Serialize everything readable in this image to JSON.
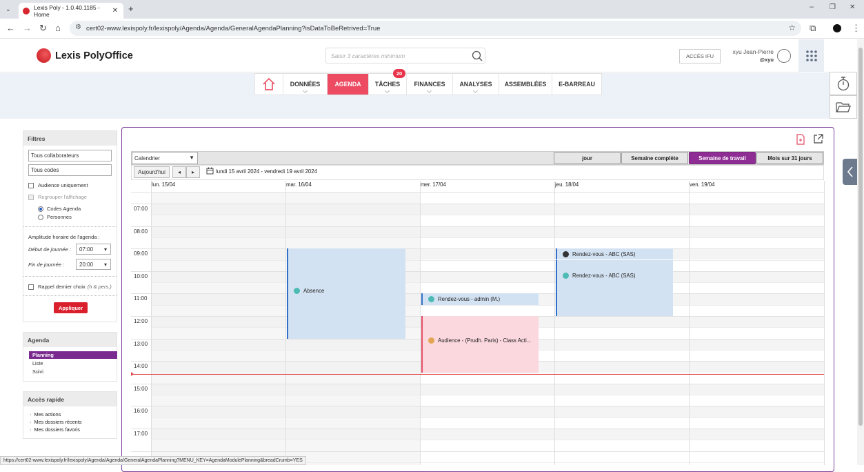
{
  "browser": {
    "tab_title": "Lexis Poly - 1.0.40.1185 - Home",
    "new_tab": "+",
    "url": "cert02-www.lexispoly.fr/lexispoly/Agenda/Agenda/GeneralAgendaPlanning?isDataToBeRetrived=True",
    "status_url": "https://cert02-www.lexispoly.fr/lexispoly/Agenda/Agenda/GeneralAgendaPlanning?MENU_KEY=AgendaModulePlanning&breadCrumb=YES"
  },
  "header": {
    "brand": "Lexis PolyOffice",
    "search_placeholder": "Saisir 3 caractères minimum",
    "ifu_button": "ACCÈS IFU",
    "user_name": "xyu Jean-Pierre",
    "user_login": "@xyu"
  },
  "nav": {
    "items": [
      "DONNÉES",
      "AGENDA",
      "TÂCHES",
      "FINANCES",
      "ANALYSES",
      "ASSEMBLÉES",
      "E-BARREAU"
    ],
    "active": "AGENDA",
    "tasks_badge": "20"
  },
  "filters": {
    "title": "Filtres",
    "collaborators": "Tous collaborateurs",
    "codes": "Tous codes",
    "audience_only": "Audience uniquement",
    "group_display": "Regrouper l'affichage",
    "radio_codes": "Codes Agenda",
    "radio_persons": "Personnes",
    "range_title": "Amplitude horaire de l'agenda :",
    "start_label": "Début de journée :",
    "start_value": "07:00",
    "end_label": "Fin de journée :",
    "end_value": "20:00",
    "recall_label": "Rappel dernier choix",
    "recall_hint": "(h & pers.)",
    "apply": "Appliquer"
  },
  "agenda_menu": {
    "title": "Agenda",
    "items": [
      "Planning",
      "Liste",
      "Suivi"
    ],
    "active": "Planning"
  },
  "quick_access": {
    "title": "Accès rapide",
    "items": [
      "Mes actions",
      "Mes dossiers récents",
      "Mes dossiers favoris"
    ]
  },
  "calendar": {
    "source": "Calendrier",
    "views": [
      "jour",
      "Semaine complète",
      "Semaine de travail",
      "Mois sur 31 jours"
    ],
    "active_view": "Semaine de travail",
    "today": "Aujourd'hui",
    "prev": "◂",
    "next": "▸",
    "range": "lundi 15 avril 2024 - vendredi 19 avril 2024",
    "days": [
      "lun. 15/04",
      "mar. 16/04",
      "mer. 17/04",
      "jeu. 18/04",
      "ven. 19/04"
    ],
    "hours": [
      "07:00",
      "08:00",
      "09:00",
      "10:00",
      "11:00",
      "12:00",
      "13:00",
      "14:00",
      "15:00",
      "16:00",
      "17:00"
    ],
    "events": [
      {
        "label": "Absence",
        "day": 1,
        "start": "09:00",
        "end": "13:00",
        "color": "#d3e2f2",
        "bar": "#2f6fc7",
        "dot": "#4dbab4"
      },
      {
        "label": "Rendez-vous - admin (M.)",
        "day": 2,
        "start": "11:00",
        "end": "11:30",
        "color": "#d3e2f2",
        "bar": "#2f6fc7",
        "dot": "#4dbab4"
      },
      {
        "label": "Audience - (Prudh. Paris) - Class Acti...",
        "day": 2,
        "start": "12:00",
        "end": "14:30",
        "color": "#fbd7de",
        "bar": "#e24a64",
        "dot": "#e3a552"
      },
      {
        "label": "Rendez-vous - ABC (SAS)",
        "day": 3,
        "start": "09:00",
        "end": "09:30",
        "color": "#d3e2f2",
        "bar": "#2f6fc7",
        "dot": "#333333"
      },
      {
        "label": "Rendez-vous - ABC (SAS)",
        "day": 3,
        "start": "09:30",
        "end": "12:00",
        "color": "#d3e2f2",
        "bar": "#2f6fc7",
        "dot": "#4dbab4"
      }
    ],
    "now_time": "14:35"
  }
}
